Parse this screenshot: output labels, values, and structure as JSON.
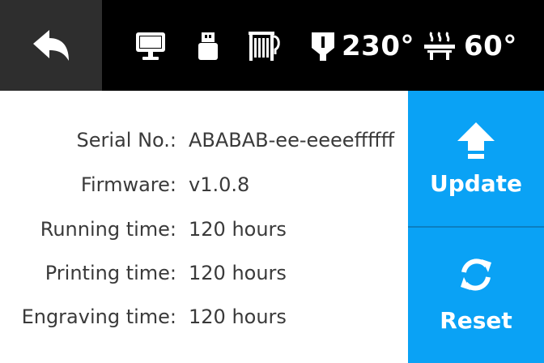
{
  "topbar": {
    "nozzle_temp": "230°",
    "bed_temp": "60°",
    "icons": [
      "back-arrow-icon",
      "monitor-icon",
      "usb-icon",
      "filament-spool-icon",
      "nozzle-icon",
      "heated-bed-icon"
    ]
  },
  "info": {
    "rows": [
      {
        "label": "Serial No.:",
        "value": "ABABAB-ee-eeeeffffff"
      },
      {
        "label": "Firmware:",
        "value": "v1.0.8"
      },
      {
        "label": "Running time:",
        "value": "120 hours"
      },
      {
        "label": "Printing time:",
        "value": "120 hours"
      },
      {
        "label": "Engraving time:",
        "value": "120 hours"
      }
    ]
  },
  "actions": {
    "update_label": "Update",
    "reset_label": "Reset"
  },
  "colors": {
    "topbar_bg": "#000000",
    "back_bg": "#2e2e2e",
    "accent": "#0aa2f5"
  }
}
